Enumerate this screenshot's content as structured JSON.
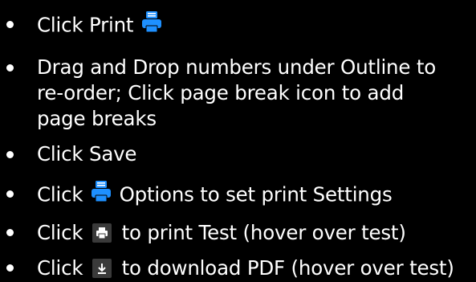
{
  "instructions": [
    {
      "id": "print",
      "before": "Click Print",
      "icon": "printer-icon",
      "after": ""
    },
    {
      "id": "drag",
      "lines": [
        "Drag and Drop numbers under Outline to",
        "re-order; Click page break icon to add",
        "page breaks"
      ]
    },
    {
      "id": "save",
      "before": "Click Save"
    },
    {
      "id": "options",
      "before": "Click",
      "icon": "printer-icon",
      "after": "Options to set print Settings"
    },
    {
      "id": "print-test",
      "before": "Click",
      "icon": "small-print-icon",
      "after": "to print Test (hover over test)"
    },
    {
      "id": "download",
      "before": "Click",
      "icon": "download-icon",
      "after": "to download PDF (hover over test)"
    }
  ],
  "colors": {
    "background": "#000000",
    "text": "#ffffff",
    "printer_icon": "#1e90ff",
    "button_bg": "#3a3a3a"
  }
}
